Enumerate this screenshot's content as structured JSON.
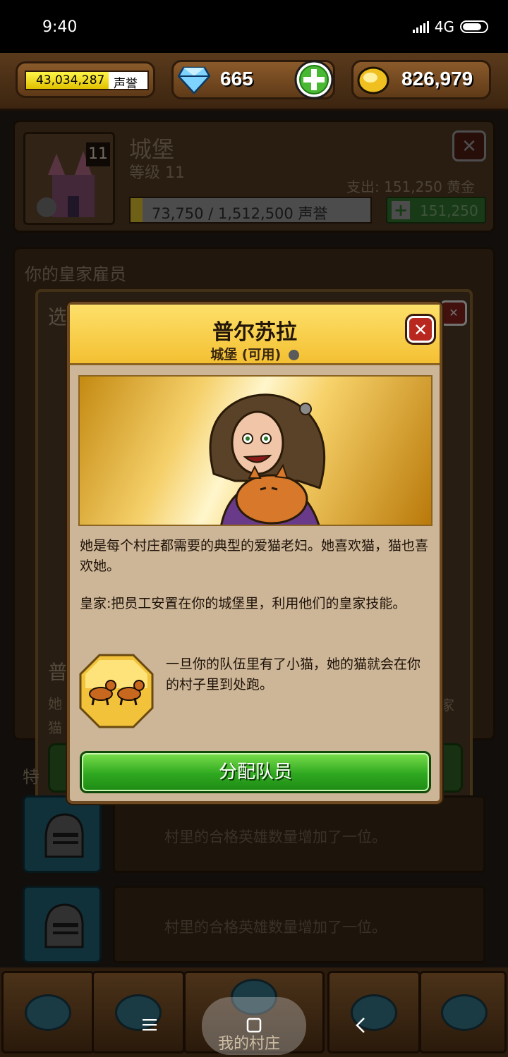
{
  "status": {
    "time": "9:40",
    "network": "4G"
  },
  "resources": {
    "prestige_value": "43,034,287",
    "prestige_unit": "声誉",
    "gems": "665",
    "gold": "826,979"
  },
  "building": {
    "level_badge": "11",
    "name": "城堡",
    "level_text": "等级 11",
    "cost_text": "支出: 151,250 黄金",
    "progress_text": "73,750 / 1,512,500 声誉",
    "progress_fraction": 0.049,
    "upgrade_cost": "151,250"
  },
  "employees_section": {
    "title": "你的皇家雇员"
  },
  "background_popup": {
    "title_fragment": "选"
  },
  "background_text": {
    "frag1": "普",
    "frag2": "她",
    "frag3": "猫",
    "frag4": "特",
    "frag5": "家"
  },
  "perks": [
    {
      "text": "村里的合格英雄数量增加了一位。"
    },
    {
      "text": "村里的合格英雄数量增加了一位。"
    }
  ],
  "modal": {
    "title": "普尔苏拉",
    "subtitle": "城堡 (可用)",
    "description": "她是每个村庄都需要的典型的爱猫老妇。她喜欢猫，猫也喜欢她。",
    "royal_text": "皇家:把员工安置在你的城堡里，利用他们的皇家技能。",
    "skill_text": "一旦你的队伍里有了小猫，她的猫就会在你的村子里到处跑。",
    "assign_label": "分配队员"
  },
  "bottom_nav": {
    "center_label": "我的村庄"
  },
  "colors": {
    "accent_green": "#2fa820",
    "header_yellow": "#f4c032",
    "close_red": "#b8281e"
  }
}
